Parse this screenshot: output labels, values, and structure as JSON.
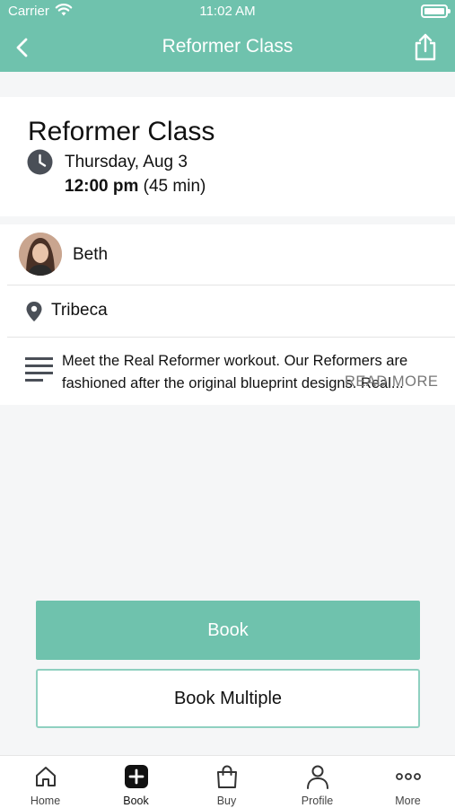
{
  "status_bar": {
    "carrier": "Carrier",
    "time": "11:02 AM"
  },
  "nav": {
    "title": "Reformer Class",
    "back_icon": "chevron-left-icon",
    "share_icon": "share-icon"
  },
  "class": {
    "title": "Reformer Class",
    "date": "Thursday, Aug 3",
    "start_time": "12:00 pm",
    "duration": "(45 min)"
  },
  "instructor": {
    "name": "Beth"
  },
  "location": {
    "name": "Tribeca"
  },
  "description": {
    "text": "Meet the Real Reformer workout. Our Reformers are fashioned after the original blueprint designs. Real...",
    "read_more": "READ MORE"
  },
  "actions": {
    "book_label": "Book",
    "book_multiple_label": "Book Multiple"
  },
  "tabs": [
    {
      "label": "Home",
      "icon": "home-icon"
    },
    {
      "label": "Book",
      "icon": "plus-square-icon"
    },
    {
      "label": "Buy",
      "icon": "shopping-bag-icon"
    },
    {
      "label": "Profile",
      "icon": "person-icon"
    },
    {
      "label": "More",
      "icon": "more-dots-icon"
    }
  ],
  "colors": {
    "accent": "#6fc2ad",
    "border_accent": "#8fd0c0",
    "background": "#f5f6f7"
  }
}
